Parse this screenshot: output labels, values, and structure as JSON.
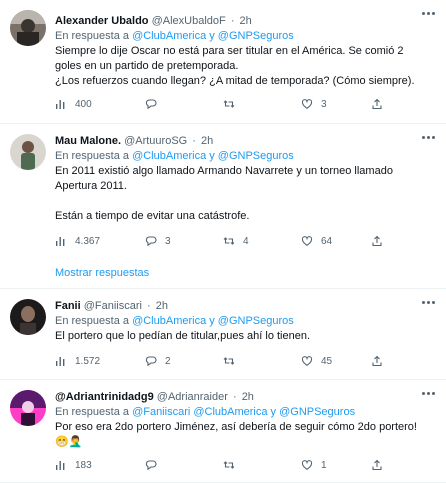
{
  "tweets": [
    {
      "name": "Alexander Ubaldo",
      "handle": "@AlexUbaldoF",
      "time": "2h",
      "replying_prefix": "En respuesta a",
      "mentions": "@ClubAmerica y @GNPSeguros",
      "lines": [
        "Siempre lo dije Oscar no está para ser titular en el América. Se comió 2",
        "goles en un partido de pretemporada.",
        "¿Los refuerzos cuando llegan? ¿A mitad de temporada? (Cómo siempre)."
      ],
      "views": "400",
      "replies": "",
      "retweets": "",
      "likes": "3"
    },
    {
      "name": "Mau Malone.",
      "handle": "@ArtuuroSG",
      "time": "2h",
      "replying_prefix": "En respuesta a",
      "mentions": "@ClubAmerica y @GNPSeguros",
      "lines": [
        "En 2011 existió algo llamado Armando Navarrete y un torneo llamado",
        "Apertura 2011.",
        "Están a tiempo de evitar una catástrofe."
      ],
      "views": "4.367",
      "replies": "3",
      "retweets": "4",
      "likes": "64"
    },
    {
      "name": "Fanii",
      "handle": "@Faniiscari",
      "time": "2h",
      "replying_prefix": "En respuesta a",
      "mentions": "@ClubAmerica y @GNPSeguros",
      "lines": [
        "El portero que lo pedían de titular,pues ahí lo tienen."
      ],
      "views": "1.572",
      "replies": "2",
      "retweets": "",
      "likes": "45"
    },
    {
      "name": "@Adriantrinidadg9",
      "handle": "@Adrianraider",
      "time": "2h",
      "replying_prefix": "En respuesta a",
      "mentions": "@Faniiscari @ClubAmerica y @GNPSeguros",
      "lines": [
        "Por eso era 2do portero Jiménez, así debería de seguir cómo 2do portero!"
      ],
      "emoji": "😁🤦‍♂️",
      "views": "183",
      "replies": "",
      "retweets": "",
      "likes": "1"
    }
  ],
  "show_more_replies": "Mostrar respuestas",
  "icons": {
    "more": "more-dots-icon",
    "views": "views-chart-icon",
    "reply": "reply-bubble-icon",
    "retweet": "retweet-icon",
    "like": "heart-icon"
  },
  "colors": {
    "link": "#1d9bf0",
    "muted": "#536471",
    "text": "#0f1419",
    "divider": "#eff3f4"
  }
}
